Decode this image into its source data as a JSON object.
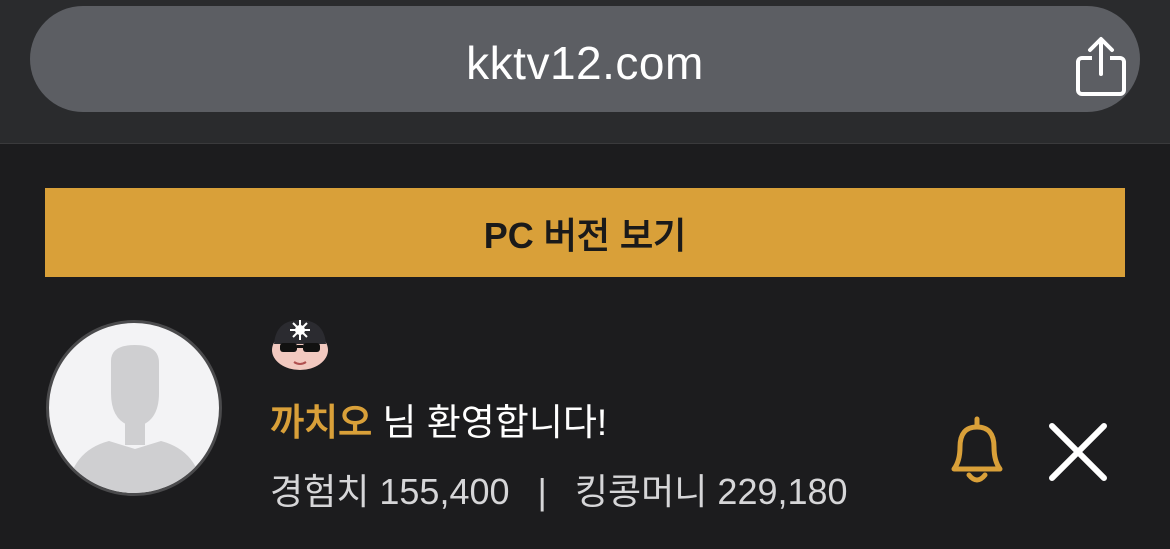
{
  "browser": {
    "url": "kktv12.com",
    "share_icon": "share-icon"
  },
  "banner": {
    "label": "PC 버전 보기",
    "color": "#d9a039"
  },
  "user": {
    "avatar_icon": "default-user-avatar-icon",
    "level_badge_icon": "sunglasses-character-badge-icon",
    "nickname": "까치오",
    "welcome_suffix": " 님 환영합니다!",
    "exp_label": "경험치",
    "exp_value": "155,400",
    "separator": "|",
    "money_label": "킹콩머니",
    "money_value": "229,180"
  },
  "actions": {
    "bell_icon": "bell-icon",
    "close_icon": "close-icon",
    "accent_color": "#d9a039"
  }
}
